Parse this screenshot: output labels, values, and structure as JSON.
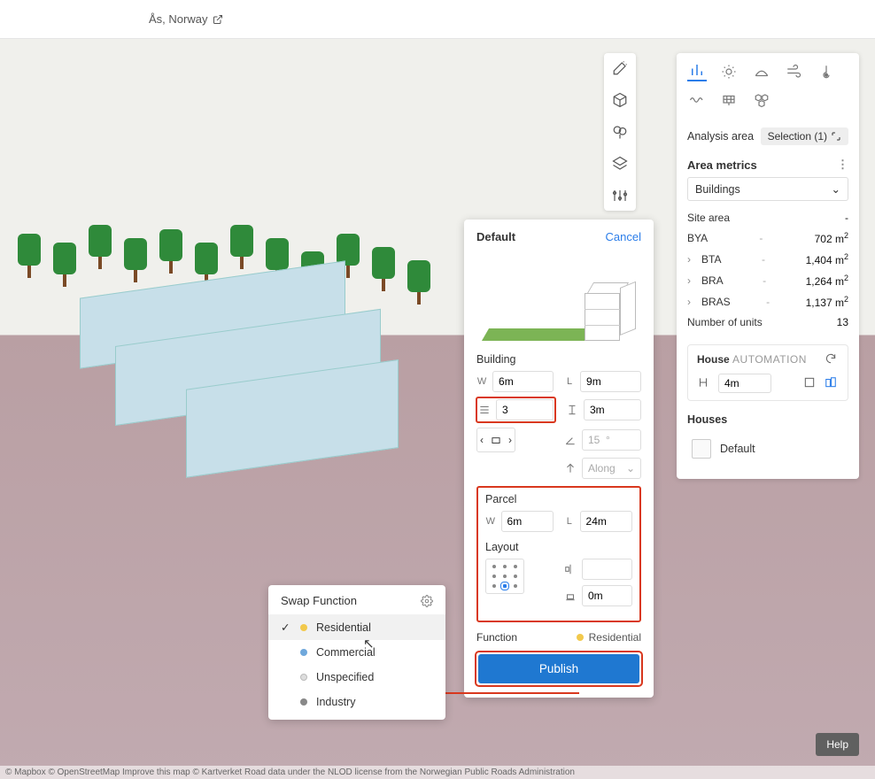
{
  "location": {
    "name": "Ås, Norway"
  },
  "toolstrip": {
    "items": [
      "wand-icon",
      "cube-icon",
      "tree-icon",
      "layers-icon",
      "sliders-icon"
    ]
  },
  "analysis": {
    "icons_row1": [
      "bars-icon",
      "sun-icon",
      "noise-icon",
      "wind-icon",
      "temperature-icon"
    ],
    "icons_row2": [
      "wave-icon",
      "solar-panel-icon",
      "cluster-icon"
    ],
    "area_label": "Analysis area",
    "selection_chip": "Selection (1)",
    "metrics_header": "Area metrics",
    "dropdown_value": "Buildings",
    "rows": [
      {
        "label": "Site area",
        "dash": "",
        "value": "-"
      },
      {
        "label": "BYA",
        "dash": "-",
        "value": "702 m²"
      },
      {
        "label": "BTA",
        "dash": "-",
        "value": "1,404 m²",
        "expand": true
      },
      {
        "label": "BRA",
        "dash": "-",
        "value": "1,264 m²",
        "expand": true
      },
      {
        "label": "BRAS",
        "dash": "-",
        "value": "1,137 m²",
        "expand": true
      },
      {
        "label": "Number of units",
        "dash": "",
        "value": "13"
      }
    ],
    "house_box": {
      "title_a": "House",
      "title_b": "AUTOMATION",
      "value": "4m"
    },
    "houses_header": "Houses",
    "house_item": "Default"
  },
  "building_panel": {
    "title": "Default",
    "cancel": "Cancel",
    "building_header": "Building",
    "W": "6m",
    "L": "9m",
    "floors": "3",
    "floor_h": "3m",
    "angle": "15  °",
    "orient_label": "Along",
    "parcel_header": "Parcel",
    "PW": "6m",
    "PL": "24m",
    "layout_header": "Layout",
    "offset": "0m",
    "function_label": "Function",
    "function_value": "Residential",
    "publish": "Publish"
  },
  "swap": {
    "title": "Swap Function",
    "items": [
      {
        "label": "Residential",
        "selected": true,
        "dot": "y"
      },
      {
        "label": "Commercial",
        "selected": false,
        "dot": "b"
      },
      {
        "label": "Unspecified",
        "selected": false,
        "dot": "o"
      },
      {
        "label": "Industry",
        "selected": false,
        "dot": "g"
      }
    ]
  },
  "help": "Help",
  "attribution": "© Mapbox  © OpenStreetMap  Improve this map  © Kartverket  Road data under the NLOD license from the Norwegian Public Roads Administration"
}
